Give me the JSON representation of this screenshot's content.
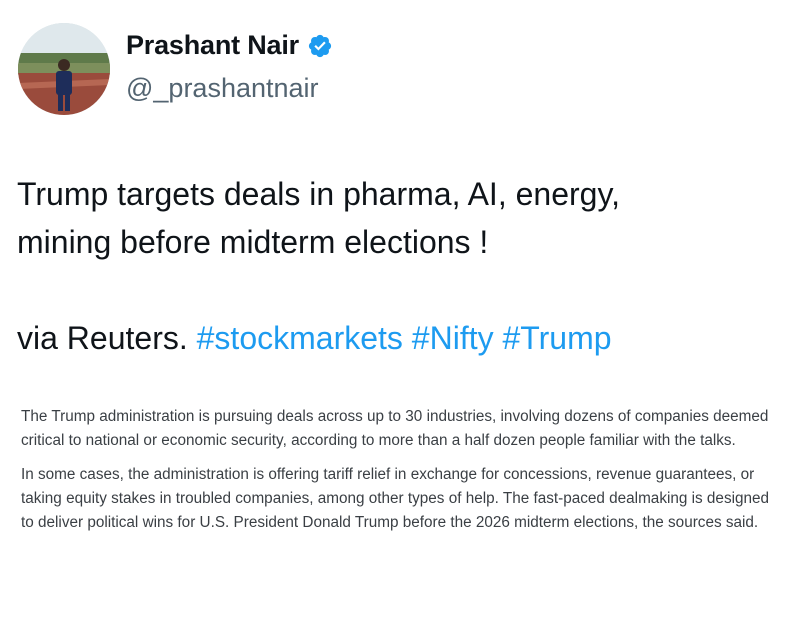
{
  "author": {
    "display_name": "Prashant Nair",
    "handle": "@_prashantnair",
    "verified_icon": "verified-badge-icon",
    "verified_color": "#1d9bf0"
  },
  "tweet": {
    "line1": "Trump targets deals in pharma, AI, energy,",
    "line2": "mining before midterm elections !",
    "via_text": "via Reuters.",
    "hashtags": [
      "#stockmarkets",
      "#Nifty",
      "#Trump"
    ],
    "hashtag_color": "#1d9bf0"
  },
  "article": {
    "paragraph1": "The Trump administration is pursuing deals across up to 30 industries, involving dozens of companies deemed critical to national or economic security, according to more than a half dozen people familiar with the talks.",
    "paragraph2": "In some cases, the administration is offering tariff relief in exchange for concessions, revenue guarantees, or taking equity stakes in troubled companies, among other types of help. The fast-paced dealmaking is designed to deliver political wins for U.S. President Donald Trump before the 2026 midterm elections, the sources said."
  }
}
